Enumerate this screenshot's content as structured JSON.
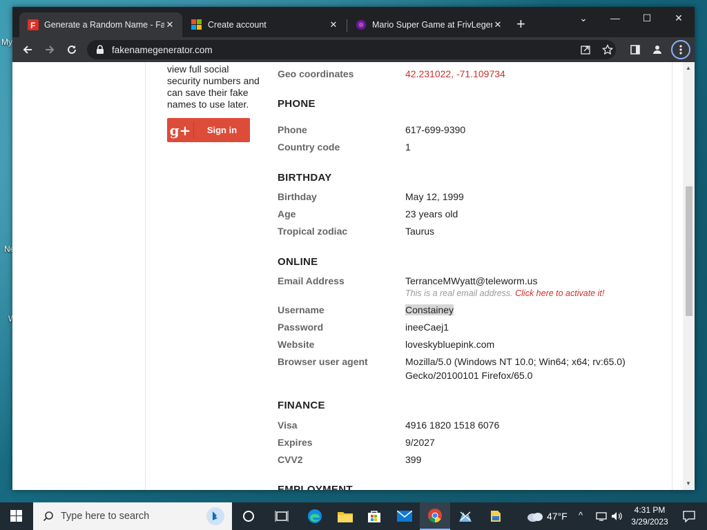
{
  "desktop": {
    "labels": [
      "My",
      "Ne",
      "W"
    ]
  },
  "browser": {
    "tabs": [
      {
        "title": "Generate a Random Name - Fake",
        "favicon": "F",
        "active": true
      },
      {
        "title": "Create account",
        "favicon": "windows-logo",
        "active": false
      },
      {
        "title": "Mario Super Game at FrivLegend",
        "favicon": "friv-logo",
        "active": false
      }
    ],
    "new_tab": "+",
    "window_controls": {
      "chevron": "⌄",
      "minimize": "—",
      "maximize": "☐",
      "close": "✕"
    },
    "url": "fakenamegenerator.com"
  },
  "sidebar": {
    "signup_text": "view full social security numbers and can save their fake names to use later.",
    "gplus_icon": "g+",
    "gplus_label": "Sign in"
  },
  "details": {
    "geo": {
      "label": "Geo coordinates",
      "value": "42.231022, -71.109734"
    },
    "phone_section": "PHONE",
    "phone": {
      "label": "Phone",
      "value": "617-699-9390"
    },
    "country_code": {
      "label": "Country code",
      "value": "1"
    },
    "birthday_section": "BIRTHDAY",
    "birthday": {
      "label": "Birthday",
      "value": "May 12, 1999"
    },
    "age": {
      "label": "Age",
      "value": "23 years old"
    },
    "zodiac": {
      "label": "Tropical zodiac",
      "value": "Taurus"
    },
    "online_section": "ONLINE",
    "email": {
      "label": "Email Address",
      "value": "TerranceMWyatt@teleworm.us"
    },
    "email_note": "This is a real email address.",
    "email_link": "Click here to activate it!",
    "username": {
      "label": "Username",
      "value": "Constainey"
    },
    "password": {
      "label": "Password",
      "value": "ineeCaej1"
    },
    "website": {
      "label": "Website",
      "value": "loveskybluepink.com"
    },
    "user_agent": {
      "label": "Browser user agent",
      "value_line1": "Mozilla/5.0 (Windows NT 10.0; Win64; x64; rv:65.0)",
      "value_line2": "Gecko/20100101 Firefox/65.0"
    },
    "finance_section": "FINANCE",
    "visa": {
      "label": "Visa",
      "value": "4916 1820 1518 6076"
    },
    "expires": {
      "label": "Expires",
      "value": "9/2027"
    },
    "cvv2": {
      "label": "CVV2",
      "value": "399"
    },
    "employment_section": "EMPLOYMENT"
  },
  "taskbar": {
    "search_placeholder": "Type here to search",
    "weather": "47°F",
    "time": "4:31 PM",
    "date": "3/29/2023"
  },
  "colors": {
    "accent_red": "#c9302c",
    "gplus_red": "#dd4b39",
    "chrome_dark": "#202124"
  }
}
